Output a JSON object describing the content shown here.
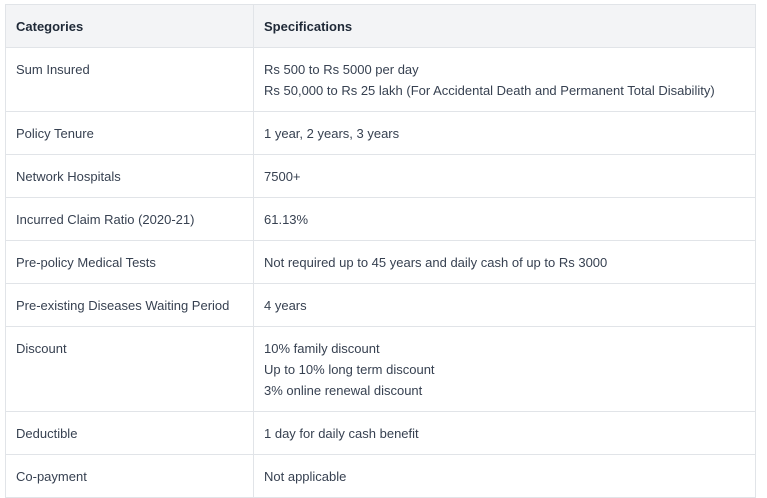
{
  "table": {
    "headers": [
      "Categories",
      "Specifications"
    ],
    "rows": [
      {
        "category": "Sum Insured",
        "spec": [
          "Rs 500 to Rs 5000 per day",
          "Rs 50,000 to Rs 25 lakh (For Accidental Death and Permanent Total Disability)"
        ]
      },
      {
        "category": "Policy Tenure",
        "spec": [
          "1 year, 2 years, 3 years"
        ]
      },
      {
        "category": "Network Hospitals",
        "spec": [
          "7500+"
        ]
      },
      {
        "category": "Incurred Claim Ratio (2020-21)",
        "spec": [
          "61.13%"
        ]
      },
      {
        "category": "Pre-policy Medical Tests",
        "spec": [
          "Not required up to 45 years and daily cash of up to Rs 3000"
        ]
      },
      {
        "category": "Pre-existing Diseases Waiting Period",
        "spec": [
          "4 years"
        ]
      },
      {
        "category": "Discount",
        "spec": [
          "10% family discount",
          "Up to 10% long term discount",
          "3% online renewal discount"
        ]
      },
      {
        "category": "Deductible",
        "spec": [
          "1 day for daily cash benefit"
        ]
      },
      {
        "category": "Co-payment",
        "spec": [
          "Not applicable"
        ]
      }
    ]
  }
}
